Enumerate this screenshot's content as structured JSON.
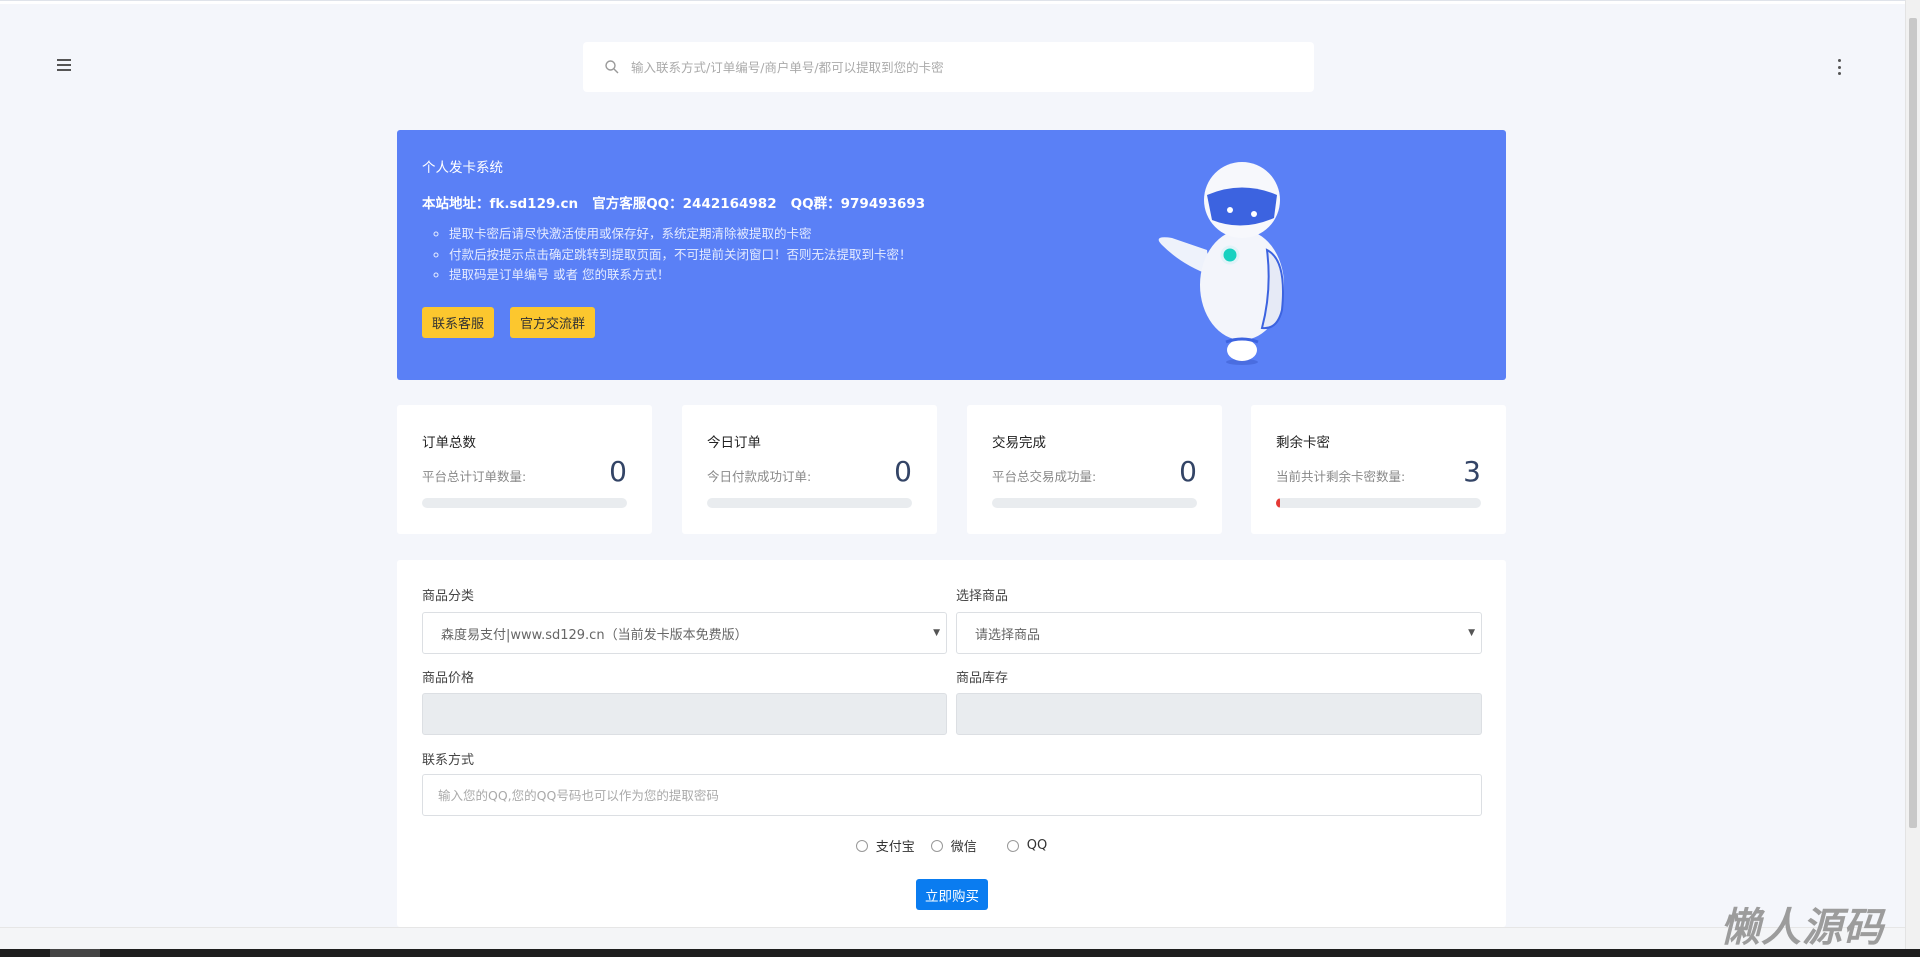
{
  "header": {
    "search_placeholder": "输入联系方式/订单编号/商户单号/都可以提取到您的卡密"
  },
  "banner": {
    "title": "个人发卡系统",
    "info": "本站地址：fk.sd129.cn   官方客服QQ：2442164982   QQ群：979493693",
    "notes": [
      "提取卡密后请尽快激活使用或保存好，系统定期清除被提取的卡密",
      "付款后按提示点击确定跳转到提取页面，不可提前关闭窗口！否则无法提取到卡密！",
      "提取码是订单编号 或者 您的联系方式！"
    ],
    "buttons": [
      "联系客服",
      "官方交流群"
    ]
  },
  "stats": [
    {
      "title": "订单总数",
      "label": "平台总计订单数量:",
      "value": "0",
      "progress": 0
    },
    {
      "title": "今日订单",
      "label": "今日付款成功订单:",
      "value": "0",
      "progress": 0
    },
    {
      "title": "交易完成",
      "label": "平台总交易成功量:",
      "value": "0",
      "progress": 0
    },
    {
      "title": "剩余卡密",
      "label": "当前共计剩余卡密数量:",
      "value": "3",
      "progress": 0.02
    }
  ],
  "form": {
    "category_label": "商品分类",
    "category_value": "森度易支付|www.sd129.cn（当前发卡版本免费版）",
    "product_label": "选择商品",
    "product_value": "请选择商品",
    "price_label": "商品价格",
    "stock_label": "商品库存",
    "contact_label": "联系方式",
    "contact_placeholder": "输入您的QQ,您的QQ号码也可以作为您的提取密码",
    "payments": [
      "支付宝",
      "微信",
      "QQ"
    ],
    "buy_label": "立即购买"
  },
  "watermark": "懒人源码",
  "colors": {
    "banner": "#5a80f6",
    "accent": "#fcc72e",
    "primary": "#0a7cf0",
    "danger": "#e53935"
  }
}
